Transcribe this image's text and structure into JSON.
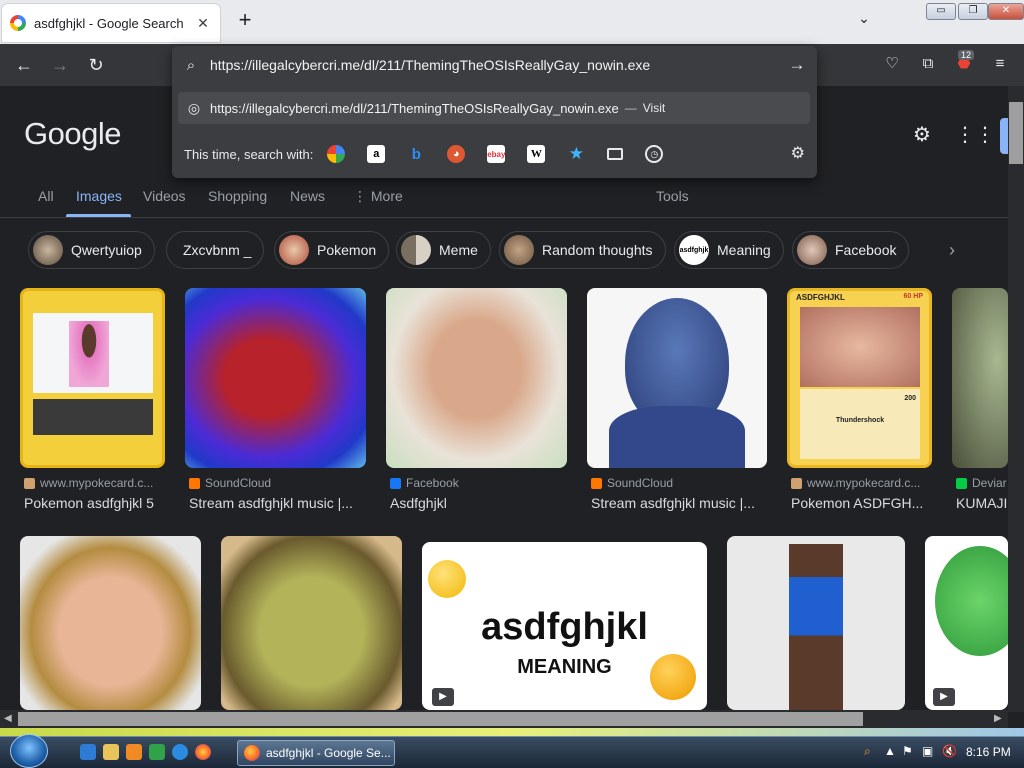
{
  "tab": {
    "title": "asdfghjkl - Google Search"
  },
  "window_controls": {
    "minimize": "▭",
    "restore": "❐",
    "close": "✕"
  },
  "url": {
    "value": "https://illegalcybercri.me/dl/211/ThemingTheOSIsReallyGay_nowin.exe",
    "suggestion": "https://illegalcybercri.me/dl/211/ThemingTheOSIsReallyGay_nowin.exe",
    "suggestion_sep": "—",
    "suggestion_action": "Visit",
    "engines_label": "This time, search with:"
  },
  "toolbar": {
    "extensions_badge": "12"
  },
  "google": {
    "logo": "Google",
    "tabs": [
      "All",
      "Images",
      "Videos",
      "Shopping",
      "News",
      "More",
      "Tools"
    ],
    "chips": [
      "Qwertyuiop",
      "Zxcvbnm _",
      "Pokemon",
      "Meme",
      "Random thoughts",
      "Meaning",
      "Facebook"
    ],
    "results_row1": [
      {
        "source": "www.mypokecard.c...",
        "caption": "Pokemon asdfghjkl 5"
      },
      {
        "source": "SoundCloud",
        "caption": "Stream asdfghjkl music |..."
      },
      {
        "source": "Facebook",
        "caption": "Asdfghjkl"
      },
      {
        "source": "SoundCloud",
        "caption": "Stream asdfghjkl music |..."
      },
      {
        "source": "www.mypokecard.c...",
        "caption": "Pokemon ASDFGH..."
      },
      {
        "source": "Deviar",
        "caption": "KUMAJII"
      }
    ],
    "meaning_card": {
      "word": "asdfghjkl",
      "sub": "MEANING"
    },
    "pokecard_labels": {
      "name": "ASDFGHJKL",
      "hp": "60 HP",
      "move": "Thundershock",
      "damage": "200"
    },
    "chip_meaning_avatar_text": "asdfghjk"
  },
  "taskbar": {
    "window_button": "asdfghjkl - Google Se...",
    "time": "8:16 PM"
  },
  "colors": {
    "accent": "#8ab4f8",
    "background": "#202124",
    "toolbar": "#35363a"
  }
}
